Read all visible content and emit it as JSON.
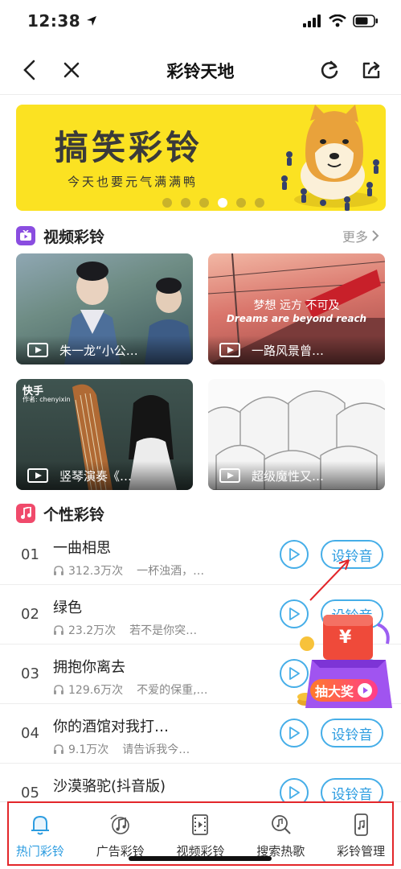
{
  "status": {
    "time": "12:38"
  },
  "nav": {
    "title": "彩铃天地"
  },
  "banner": {
    "title": "搞笑彩铃",
    "subtitle": "今天也要元气满满鸭",
    "dots": 6,
    "active_dot": 4
  },
  "video_section": {
    "title": "视频彩铃",
    "more": "更多",
    "videos": [
      {
        "caption": "朱一龙“小公…"
      },
      {
        "caption": "一路风景曾…",
        "overlay_line1": "梦想 远方 不可及",
        "overlay_line2": "Dreams are beyond reach"
      },
      {
        "caption": "竖琴演奏《…",
        "badge": "快手",
        "badge_sub": "作者: chenyixin"
      },
      {
        "caption": "超级魔性又…"
      }
    ]
  },
  "song_section": {
    "title": "个性彩铃",
    "set_label": "设铃音",
    "songs": [
      {
        "rank": "01",
        "title": "一曲相思",
        "plays": "312.3万次",
        "desc": "一杯浊酒，…"
      },
      {
        "rank": "02",
        "title": "绿色",
        "plays": "23.2万次",
        "desc": "若不是你突…"
      },
      {
        "rank": "03",
        "title": "拥抱你离去",
        "plays": "129.6万次",
        "desc": "不爱的保重,…"
      },
      {
        "rank": "04",
        "title": "你的酒馆对我打…",
        "plays": "9.1万次",
        "desc": "请告诉我今…"
      },
      {
        "rank": "05",
        "title": "沙漠骆驼(抖音版)",
        "plays": "",
        "desc": ""
      }
    ]
  },
  "lottery": {
    "label": "抽大奖",
    "currency": "¥"
  },
  "tabs": [
    {
      "label": "热门彩铃",
      "icon": "bell-icon",
      "active": true
    },
    {
      "label": "广告彩铃",
      "icon": "music-note-icon",
      "active": false
    },
    {
      "label": "视频彩铃",
      "icon": "video-film-icon",
      "active": false
    },
    {
      "label": "搜索热歌",
      "icon": "search-music-icon",
      "active": false
    },
    {
      "label": "彩铃管理",
      "icon": "phone-music-icon",
      "active": false
    }
  ],
  "colors": {
    "accent": "#2c9ce0",
    "banner_bg": "#fbe222",
    "annotation": "#e3262a"
  }
}
